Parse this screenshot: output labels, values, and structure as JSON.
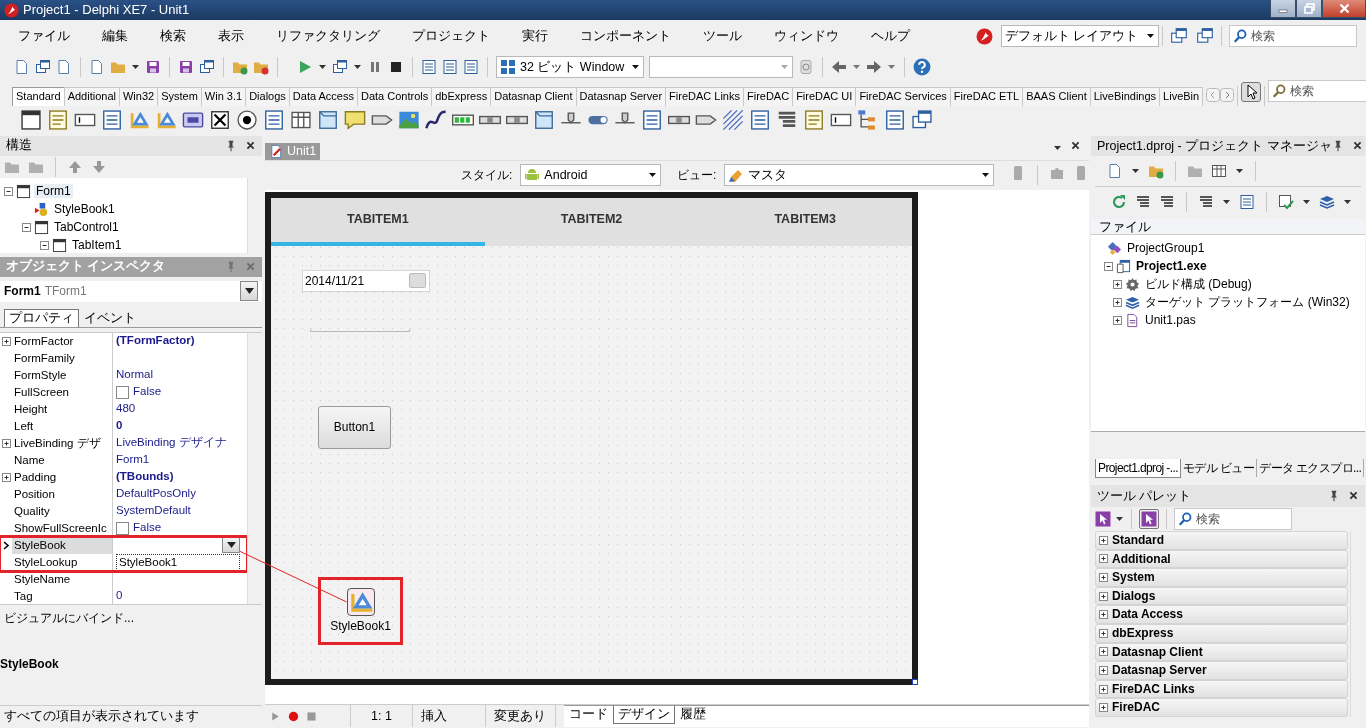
{
  "window": {
    "title": "Project1 - Delphi XE7 - Unit1"
  },
  "menu": [
    "ファイル",
    "編集",
    "検索",
    "表示",
    "リファクタリング",
    "プロジェクト",
    "実行",
    "コンポーネント",
    "ツール",
    "ウィンドウ",
    "ヘルプ"
  ],
  "layout": {
    "value": "デフォルト レイアウト"
  },
  "ide_search": {
    "placeholder": "検索"
  },
  "platform": {
    "value": "32 ビット Window"
  },
  "palette_tabs": [
    {
      "label": "Standard",
      "selected": true
    },
    {
      "label": "Additional",
      "selected": false
    },
    {
      "label": "Win32",
      "selected": false
    },
    {
      "label": "System",
      "selected": false
    },
    {
      "label": "Win 3.1",
      "selected": false
    },
    {
      "label": "Dialogs",
      "selected": false
    },
    {
      "label": "Data Access",
      "selected": false
    },
    {
      "label": "Data Controls",
      "selected": false
    },
    {
      "label": "dbExpress",
      "selected": false
    },
    {
      "label": "Datasnap Client",
      "selected": false
    },
    {
      "label": "Datasnap Server",
      "selected": false
    },
    {
      "label": "FireDAC Links",
      "selected": false
    },
    {
      "label": "FireDAC",
      "selected": false
    },
    {
      "label": "FireDAC UI",
      "selected": false
    },
    {
      "label": "FireDAC Services",
      "selected": false
    },
    {
      "label": "FireDAC ETL",
      "selected": false
    },
    {
      "label": "BAAS Client",
      "selected": false
    },
    {
      "label": "LiveBindings",
      "selected": false
    },
    {
      "label": "LiveBin",
      "selected": false
    }
  ],
  "palette_search": {
    "placeholder": "検索"
  },
  "structure": {
    "title": "構造",
    "tree": [
      {
        "label": "Form1",
        "kind": "form",
        "selected": true,
        "expanded": true,
        "children": [
          {
            "label": "StyleBook1",
            "kind": "stylebook",
            "selected": false
          },
          {
            "label": "TabControl1",
            "kind": "form",
            "selected": false,
            "expanded": true,
            "children": [
              {
                "label": "TabItem1",
                "kind": "form",
                "selected": false,
                "expanded": true
              }
            ]
          }
        ]
      }
    ]
  },
  "inspector": {
    "title": "オブジェクト インスペクタ",
    "object_name": "Form1",
    "object_type": "TForm1",
    "tabs": [
      {
        "label": "プロパティ",
        "selected": true
      },
      {
        "label": "イベント",
        "selected": false
      }
    ],
    "properties": [
      {
        "name": "FormFactor",
        "value": "(TFormFactor)",
        "kind": "text",
        "modified": true,
        "expandable": true
      },
      {
        "name": "FormFamily",
        "kind": "text",
        "expandable": false
      },
      {
        "name": "FormStyle",
        "value": "Normal",
        "kind": "text",
        "modified": false,
        "expandable": false
      },
      {
        "name": "FullScreen",
        "value": "False",
        "kind": "checkbox",
        "checked": false,
        "modified": false,
        "expandable": false
      },
      {
        "name": "Height",
        "value": "480",
        "kind": "text",
        "modified": false,
        "expandable": false
      },
      {
        "name": "Left",
        "value": "0",
        "kind": "text",
        "modified": true,
        "expandable": false
      },
      {
        "name": "LiveBinding デザ",
        "value": "LiveBinding デザイナ",
        "kind": "text",
        "modified": false,
        "expandable": true
      },
      {
        "name": "Name",
        "value": "Form1",
        "kind": "text",
        "modified": false,
        "expandable": false
      },
      {
        "name": "Padding",
        "value": "(TBounds)",
        "kind": "text",
        "modified": true,
        "expandable": true
      },
      {
        "name": "Position",
        "value": "DefaultPosOnly",
        "kind": "text",
        "modified": false,
        "expandable": false
      },
      {
        "name": "Quality",
        "value": "SystemDefault",
        "kind": "text",
        "modified": false,
        "expandable": false
      },
      {
        "name": "ShowFullScreenIc",
        "value": "False",
        "kind": "checkbox",
        "checked": false,
        "modified": false,
        "expandable": false
      },
      {
        "name": "StyleBook",
        "kind": "combo",
        "selected": true,
        "annotated": true,
        "expandable": false
      },
      {
        "name": "StyleLookup",
        "value": "StyleBook1",
        "kind": "edit",
        "annotated": true,
        "modified": false,
        "expandable": false
      },
      {
        "name": "StyleName",
        "kind": "text",
        "expandable": false
      },
      {
        "name": "Tag",
        "value": "0",
        "kind": "text",
        "modified": false,
        "expandable": false
      }
    ],
    "link": "ビジュアルにバインド...",
    "description_title": "StyleBook",
    "status": "すべての項目が表示されています"
  },
  "editor": {
    "tabs": [
      {
        "label": "Unit1",
        "selected": true
      }
    ],
    "style_label": "スタイル:",
    "style": "Android",
    "view_label": "ビュー:",
    "view": "マスタ",
    "form": {
      "tabs": [
        {
          "label": "TABITEM1",
          "selected": true
        },
        {
          "label": "TABITEM2",
          "selected": false
        },
        {
          "label": "TABITEM3",
          "selected": false
        }
      ],
      "components": [
        {
          "kind": "date-edit",
          "value": "2014/11/21"
        },
        {
          "kind": "edit"
        },
        {
          "kind": "button",
          "label": "Button1"
        },
        {
          "kind": "component",
          "label": "StyleBook1",
          "annotated": true
        }
      ]
    },
    "status": {
      "position": "1: 1",
      "mode": "挿入",
      "modified": "変更あり"
    },
    "view_tabs": [
      {
        "label": "コード",
        "selected": false
      },
      {
        "label": "デザイン",
        "selected": true
      },
      {
        "label": "履歴",
        "selected": false
      }
    ]
  },
  "project_manager": {
    "title": "Project1.dproj - プロジェクト マネージャ",
    "column": "ファイル",
    "tree": [
      {
        "label": "ProjectGroup1",
        "kind": "group",
        "active": false,
        "children": [
          {
            "label": "Project1.exe",
            "kind": "project",
            "active": true,
            "expanded": true,
            "children": [
              {
                "label": "ビルド構成 (Debug)",
                "kind": "config",
                "active": false,
                "expanded": false
              },
              {
                "label": "ターゲット プラットフォーム (Win32)",
                "kind": "platform",
                "active": false,
                "expanded": false
              },
              {
                "label": "Unit1.pas",
                "kind": "unit",
                "active": false,
                "expanded": false
              }
            ]
          }
        ]
      }
    ],
    "tabs": [
      {
        "label": "Project1.dproj -...",
        "selected": true
      },
      {
        "label": "モデル ビュー",
        "selected": false
      },
      {
        "label": "データ エクスプロ...",
        "selected": false
      }
    ]
  },
  "tool_palette": {
    "title": "ツール パレット",
    "search_placeholder": "検索",
    "categories": [
      {
        "label": "Standard",
        "expanded": false
      },
      {
        "label": "Additional",
        "expanded": false
      },
      {
        "label": "System",
        "expanded": false
      },
      {
        "label": "Dialogs",
        "expanded": false
      },
      {
        "label": "Data Access",
        "expanded": false
      },
      {
        "label": "dbExpress",
        "expanded": false
      },
      {
        "label": "Datasnap Client",
        "expanded": false
      },
      {
        "label": "Datasnap Server",
        "expanded": false
      },
      {
        "label": "FireDAC Links",
        "expanded": false
      },
      {
        "label": "FireDAC",
        "expanded": false
      }
    ]
  }
}
